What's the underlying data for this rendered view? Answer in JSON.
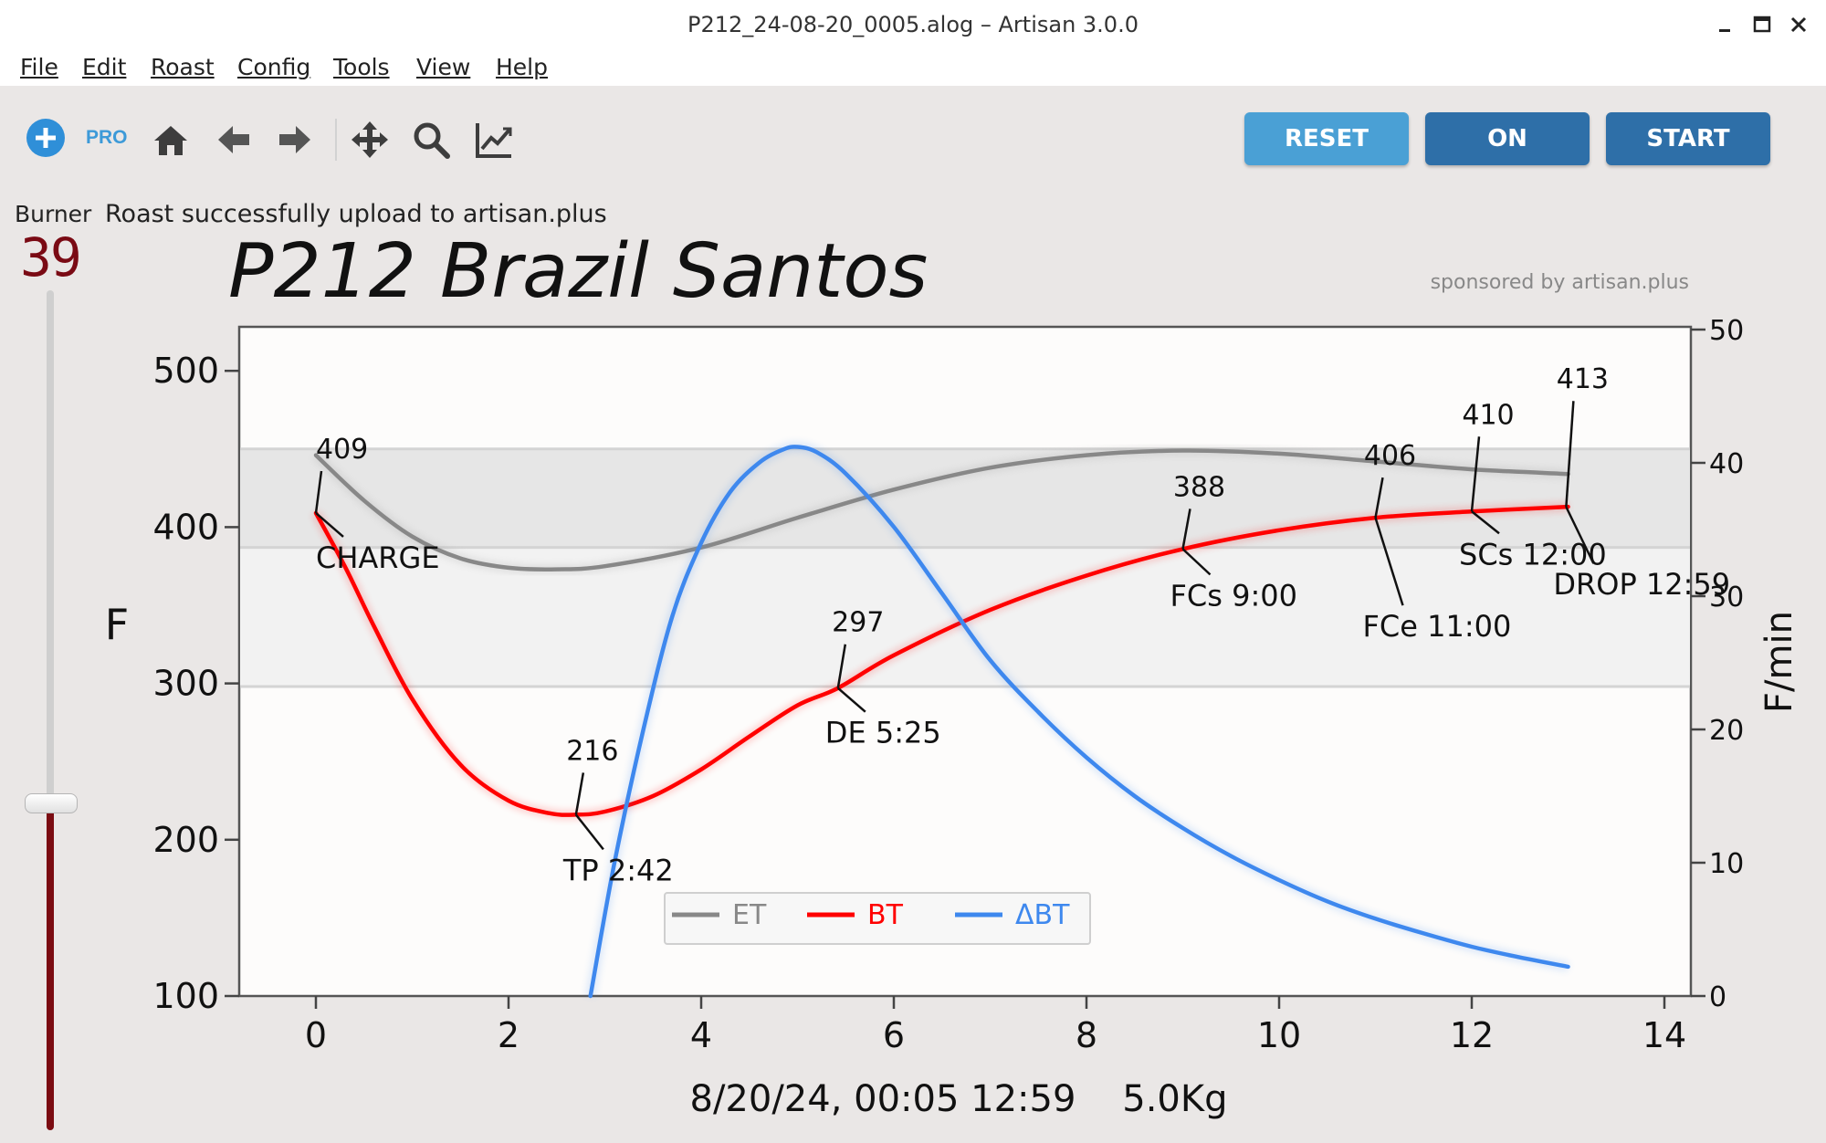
{
  "window": {
    "title": "P212_24-08-20_0005.alog – Artisan 3.0.0",
    "controls": [
      "minimize-icon",
      "maximize-icon",
      "close-icon"
    ]
  },
  "menu": [
    {
      "label": "File"
    },
    {
      "label": "Edit"
    },
    {
      "label": "Roast"
    },
    {
      "label": "Config"
    },
    {
      "label": "Tools"
    },
    {
      "label": "View"
    },
    {
      "label": "Help"
    }
  ],
  "toolbar": {
    "pro_label": "PRO",
    "icons": [
      "plus-circle-icon",
      "home-icon",
      "arrow-left-icon",
      "arrow-right-icon",
      "move-icon",
      "zoom-icon",
      "line-chart-icon"
    ],
    "buttons": {
      "reset": "RESET",
      "on": "ON",
      "start": "START"
    },
    "colors": {
      "reset": "#4aa0d5",
      "on": "#2e6fa8",
      "start": "#2e6fa8",
      "icon": "#3d3d3d",
      "add_icon": "#2f8fd8"
    }
  },
  "status": {
    "burner_label": "Burner",
    "message": "Roast successfully upload to artisan.plus",
    "burner_value": "39",
    "burner_slider_fraction": 0.39
  },
  "chart_data": {
    "type": "line",
    "title": "P212 Brazil Santos",
    "sponsor": "sponsored by artisan.plus",
    "xlabel": "8/20/24, 00:05 12:59    5.0Kg",
    "ylabel": "F",
    "y2label": "F/min",
    "xlim": [
      -0.8,
      14.3
    ],
    "ylim": [
      100,
      520
    ],
    "y2lim": [
      0,
      50
    ],
    "xticks": [
      0,
      2,
      4,
      6,
      8,
      10,
      12,
      14
    ],
    "yticks": [
      100,
      200,
      300,
      400,
      500
    ],
    "y2ticks": [
      0,
      10,
      20,
      30,
      40,
      50
    ],
    "bands": [
      {
        "from": 387,
        "to": 450,
        "color": "#e6e6e6"
      },
      {
        "from": 298,
        "to": 387,
        "color": "#f2f2f2"
      }
    ],
    "series": [
      {
        "name": "ET",
        "color": "#888888",
        "axis": "left",
        "x": [
          0,
          0.5,
          1,
          1.5,
          2,
          2.5,
          3,
          4,
          5,
          6,
          7,
          8,
          9,
          10,
          11,
          12,
          13
        ],
        "y": [
          446,
          417,
          394,
          380,
          374,
          373,
          375,
          387,
          406,
          424,
          438,
          446,
          449,
          447,
          442,
          437,
          434
        ]
      },
      {
        "name": "BT",
        "color": "#ff0000",
        "axis": "left",
        "x": [
          0,
          0.3,
          0.6,
          1,
          1.5,
          2,
          2.42,
          2.7,
          3,
          3.5,
          4,
          4.5,
          5,
          5.42,
          6,
          7,
          8,
          9,
          10,
          11,
          12,
          13
        ],
        "y": [
          409,
          375,
          337,
          290,
          248,
          225,
          217,
          216,
          218,
          228,
          245,
          266,
          286,
          297,
          318,
          347,
          369,
          386,
          398,
          406,
          410,
          413
        ]
      },
      {
        "name": "ΔBT",
        "color": "#3e88ee",
        "axis": "right",
        "x": [
          2.85,
          3.1,
          3.4,
          3.7,
          4.0,
          4.3,
          4.6,
          4.85,
          5.0,
          5.2,
          5.5,
          6,
          6.5,
          7,
          7.5,
          8,
          8.5,
          9,
          9.5,
          10,
          10.5,
          11,
          11.5,
          12,
          12.5,
          13
        ],
        "y": [
          0,
          10,
          20,
          28.5,
          34,
          37.8,
          40,
          41,
          41.2,
          40.8,
          39.2,
          35.2,
          30.2,
          25.2,
          21.3,
          17.9,
          15,
          12.6,
          10.5,
          8.7,
          7.1,
          5.8,
          4.7,
          3.7,
          2.9,
          2.2
        ]
      }
    ],
    "events": [
      {
        "label": "CHARGE",
        "x": 0,
        "temp": "409"
      },
      {
        "label": "TP 2:42",
        "x": 2.7,
        "temp": "216"
      },
      {
        "label": "DE 5:25",
        "x": 5.42,
        "temp": "297"
      },
      {
        "label": "FCs 9:00",
        "x": 9.0,
        "temp": "388"
      },
      {
        "label": "FCe 11:00",
        "x": 11.0,
        "temp": "406"
      },
      {
        "label": "SCs 12:00",
        "x": 12.0,
        "temp": "410"
      },
      {
        "label": "DROP 12:59",
        "x": 12.98,
        "temp": "413"
      }
    ],
    "legend": [
      "ET",
      "BT",
      "ΔBT"
    ],
    "legend_position": "bottom-center"
  }
}
